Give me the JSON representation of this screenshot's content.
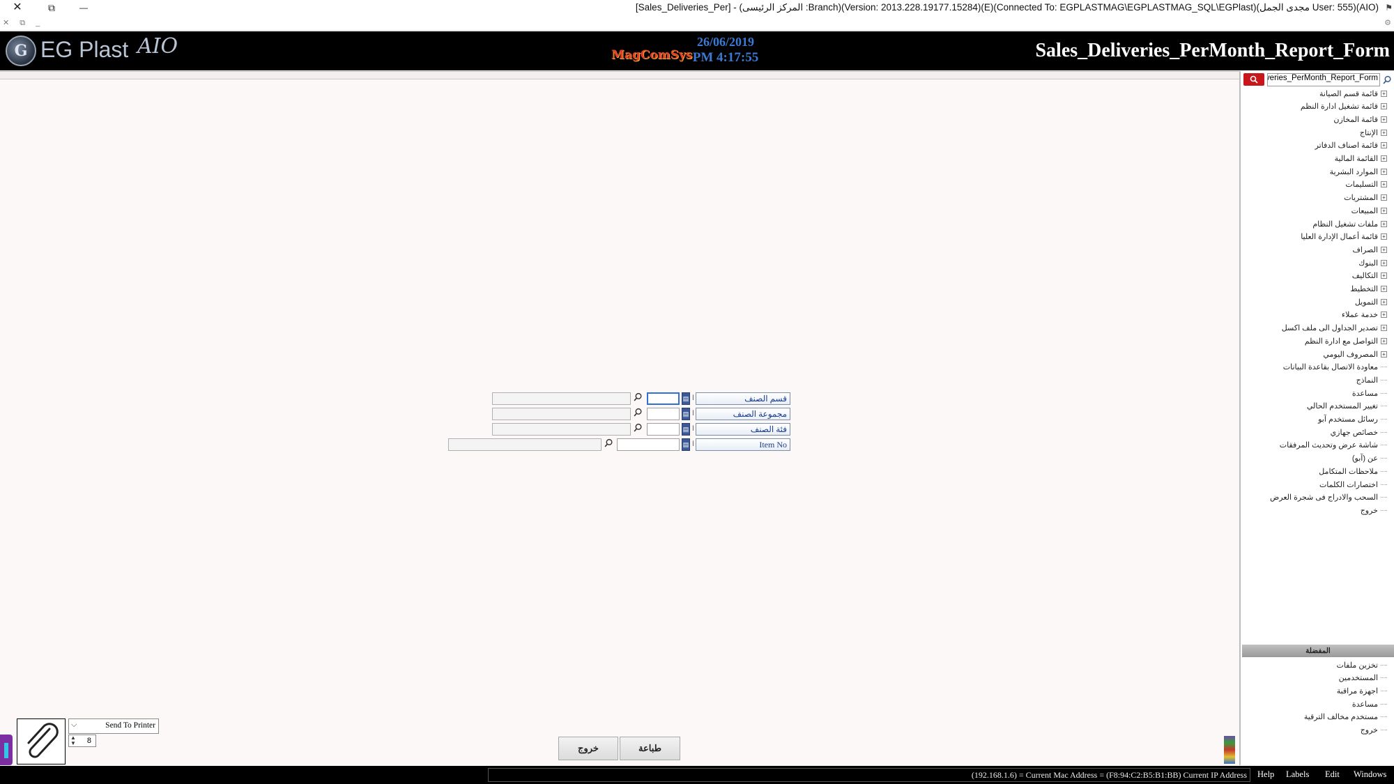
{
  "window": {
    "title": "[Sales_Deliveries_Per] - (المركز الرئيسى :Branch)(Version: 2013.228.19177.15284)(E)(Connected To: EGPLASTMAG\\EGPLASTMAG_SQL\\EGPlast)(مجدى الجمل User: 555)(AIO)",
    "close_glyph": "✕",
    "restore_glyph": "⧉",
    "minimize_glyph": "—",
    "mdi_controls": "✕ ⧉ _"
  },
  "header": {
    "logo_initial": "G",
    "logo_text": "EG Plast",
    "logo_suffix": "AIO",
    "company": "MagComSys",
    "date": "26/06/2019",
    "time": "PM 4:17:55",
    "form_title": "Sales_Deliveries_PerMonth_Report_Form"
  },
  "sidebar": {
    "search_value": "Sales_Deliveries_PerMonth_Report_Form",
    "tree": [
      {
        "label": "قائمة قسم الصيانة",
        "expandable": true
      },
      {
        "label": "قائمة تشغيل ادارة النظم",
        "expandable": true
      },
      {
        "label": "قائمة المخازن",
        "expandable": true
      },
      {
        "label": "الإنتاج",
        "expandable": true
      },
      {
        "label": "قائمة اصناف الدفاتر",
        "expandable": true
      },
      {
        "label": "القائمة المالية",
        "expandable": true
      },
      {
        "label": "الموارد البشرية",
        "expandable": true
      },
      {
        "label": "التسليمات",
        "expandable": true
      },
      {
        "label": "المشتريات",
        "expandable": true
      },
      {
        "label": "المبيعات",
        "expandable": true
      },
      {
        "label": "ملفات تشغيل النظام",
        "expandable": true
      },
      {
        "label": "قائمة أعمال الإدارة العليا",
        "expandable": true
      },
      {
        "label": "الصراف",
        "expandable": true
      },
      {
        "label": "البنوك",
        "expandable": true
      },
      {
        "label": "التكاليف",
        "expandable": true
      },
      {
        "label": "التخطيط",
        "expandable": true
      },
      {
        "label": "التمويل",
        "expandable": true
      },
      {
        "label": "خدمة عملاء",
        "expandable": true
      },
      {
        "label": "تصدير الجداول الى ملف اكسل",
        "expandable": true
      },
      {
        "label": "التواصل مع ادارة النظم",
        "expandable": true
      },
      {
        "label": "المصروف اليومي",
        "expandable": true
      },
      {
        "label": "معاودة الاتصال بقاعدة البيانات",
        "expandable": false
      },
      {
        "label": "النماذج",
        "expandable": false
      },
      {
        "label": "مساعدة",
        "expandable": false
      },
      {
        "label": "تغيير المستخدم الحالي",
        "expandable": false
      },
      {
        "label": "رسائل مستخدم آبو",
        "expandable": false
      },
      {
        "label": "خصائص جهازي",
        "expandable": false
      },
      {
        "label": "شاشة عرض وتحديث المرفقات",
        "expandable": false
      },
      {
        "label": "عن (آبو)",
        "expandable": false
      },
      {
        "label": "ملاحظات المتكامل",
        "expandable": false
      },
      {
        "label": "اختصارات الكلمات",
        "expandable": false
      },
      {
        "label": "السحب والادراج فى شجرة العرض",
        "expandable": false
      },
      {
        "label": "خروج",
        "expandable": false
      }
    ],
    "favorites_title": "المفضلة",
    "favorites": [
      {
        "label": "تخزين ملفات"
      },
      {
        "label": "المستخدمين"
      },
      {
        "label": "اجهزة مراقبة"
      },
      {
        "label": "مساعدة"
      },
      {
        "label": "مستخدم مخالف الترقية"
      },
      {
        "label": "خروج"
      }
    ]
  },
  "form": {
    "rows": [
      {
        "label": "قسم الصنف",
        "code": "",
        "name": ""
      },
      {
        "label": "مجموعة الصنف",
        "code": "",
        "name": ""
      },
      {
        "label": "فئة الصنف",
        "code": "",
        "name": ""
      },
      {
        "label": "Item No",
        "code": "",
        "name": ""
      }
    ],
    "pick_glyph": "▤",
    "marker": "ا"
  },
  "bottom": {
    "printer_option": "Send To Printer",
    "copies": "8",
    "print_button": "طباعة",
    "exit_button": "خروج"
  },
  "statusbar": {
    "info": "(192.168.1.6) = Current Mac Address = (F8:94:C2:B5:B1:BB) Current IP Address",
    "menus": [
      "Help",
      "Labels",
      "Edit",
      "Windows"
    ]
  },
  "icons": {
    "search": "search-icon",
    "attach": "paperclip-icon",
    "expand": "plus-box-icon"
  },
  "colors": {
    "header_bg": "#000000",
    "accent_blue": "#3a7bd5",
    "search_red": "#c8161d",
    "label_text": "#1a3c8c"
  }
}
